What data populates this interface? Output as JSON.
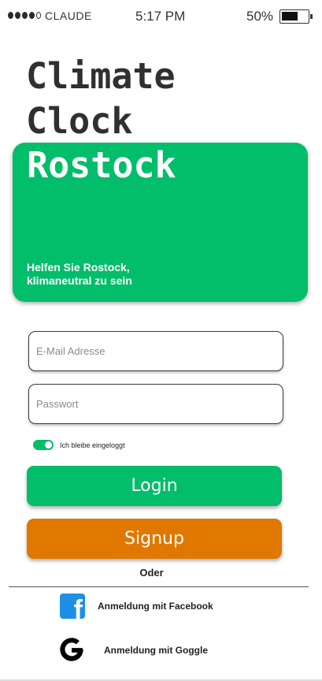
{
  "status_bar": {
    "carrier": "CLAUDE",
    "time": "5:17 PM",
    "battery_percent": "50%",
    "battery_level": 0.5
  },
  "app": {
    "title_line1": "Climate",
    "title_line2": "Clock"
  },
  "hero": {
    "city": "Rostock",
    "subtitle_line1": "Helfen Sie Rostock,",
    "subtitle_line2": "klimaneutral zu sein",
    "color": "#02bd6a"
  },
  "form": {
    "email_placeholder": "E-Mail Adresse",
    "password_placeholder": "Passwort",
    "remember_label": "Ich bleibe eingeloggt",
    "remember_on": true,
    "login_label": "Login",
    "signup_label": "Signup",
    "or_label": "Oder",
    "login_color": "#02bd6a",
    "signup_color": "#e07800"
  },
  "social": {
    "facebook_label": "Anmeldung mit Facebook",
    "facebook_icon": "facebook-icon",
    "google_label": "Anmeldung mit Goggle",
    "google_icon": "google-icon"
  }
}
